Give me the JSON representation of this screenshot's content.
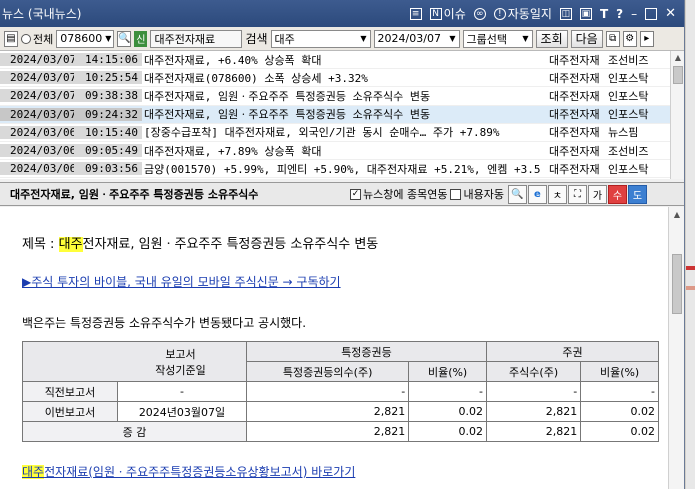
{
  "window": {
    "title": "뉴스 (국내뉴스)",
    "title_buttons": [
      {
        "icon": "news-alert-icon",
        "label": "이슈",
        "glyph": "N"
      },
      {
        "icon": "auto-diary-icon",
        "label": "자동일지",
        "glyph": "!"
      }
    ]
  },
  "toolbar": {
    "radio_all": "전체",
    "stock_code": "078600",
    "stock_badge": "신",
    "stock_name": "대주전자재료",
    "search_label": "검색",
    "search_value": "대주",
    "date_value": "2024/03/07",
    "group_select": "그룹선택",
    "btn_query": "조회",
    "btn_next": "다음"
  },
  "news_list": [
    {
      "date": "2024/03/07",
      "time": "14:15:06",
      "title": "대주전자재료, +6.40% 상승폭 확대",
      "src1": "대주전자재",
      "src2": "조선비즈",
      "selected": false
    },
    {
      "date": "2024/03/07",
      "time": "10:25:54",
      "title": "대주전자재료(078600) 소폭 상승세 +3.32%",
      "src1": "대주전자재",
      "src2": "인포스탁",
      "selected": false
    },
    {
      "date": "2024/03/07",
      "time": "09:38:38",
      "title": "대주전자재료, 임원ㆍ주요주주 특정증권등 소유주식수 변동",
      "src1": "대주전자재",
      "src2": "인포스탁",
      "selected": false
    },
    {
      "date": "2024/03/07",
      "time": "09:24:32",
      "title": "대주전자재료, 임원ㆍ주요주주 특정증권등 소유주식수 변동",
      "src1": "대주전자재",
      "src2": "인포스탁",
      "selected": true
    },
    {
      "date": "2024/03/06",
      "time": "10:15:40",
      "title": "[장중수급포착] 대주전자재료, 외국인/기관 동시 순매수… 주가 +7.89%",
      "src1": "대주전자재",
      "src2": "뉴스핌",
      "selected": false
    },
    {
      "date": "2024/03/06",
      "time": "09:05:49",
      "title": "대주전자재료, +7.89% 상승폭 확대",
      "src1": "대주전자재",
      "src2": "조선비즈",
      "selected": false
    },
    {
      "date": "2024/03/06",
      "time": "09:03:56",
      "title": "금양(001570) +5.99%, 피엔티 +5.90%, 대주전자재료 +5.21%, 엔켐 +3.5",
      "src1": "대주전자재",
      "src2": "인포스탁",
      "selected": false
    }
  ],
  "news_header": {
    "title": "대주전자재료, 임원ㆍ주요주주 특정증권등 소유주식수",
    "opt_link": "뉴스창에 종목연동",
    "opt_autoplay": "내용자동"
  },
  "article": {
    "title_prefix": "제목 : ",
    "title_hl": "대주",
    "title_rest": "전자재료, 임원ㆍ주요주주 특정증권등 소유주식수 변동",
    "promo": "▶주식 투자의 바이블, 국내 유일의 모바일 주식신문 → 구독하기",
    "body": "백은주는 특정증권등 소유주식수가 변동됐다고 공시했다.",
    "table": {
      "h_report": "보고서",
      "h_report_date": "작성기준일",
      "h_group1": "특정증권등",
      "h_group2": "주권",
      "h_sub1": "특정증권등의수(주)",
      "h_sub2": "비율(%)",
      "h_sub3": "주식수(주)",
      "h_sub4": "비율(%)",
      "rows": [
        {
          "label": "직전보고서",
          "date": "-",
          "v1": "-",
          "v2": "-",
          "v3": "-",
          "v4": "-"
        },
        {
          "label": "이번보고서",
          "date": "2024년03월07일",
          "v1": "2,821",
          "v2": "0.02",
          "v3": "2,821",
          "v4": "0.02"
        },
        {
          "label": "증 감",
          "date": "",
          "v1": "2,821",
          "v2": "0.02",
          "v3": "2,821",
          "v4": "0.02"
        }
      ]
    },
    "link_hl": "대주",
    "link_rest": "전자재료(임원ㆍ주요주주특정증권등소유상황보고서) 바로가기"
  }
}
